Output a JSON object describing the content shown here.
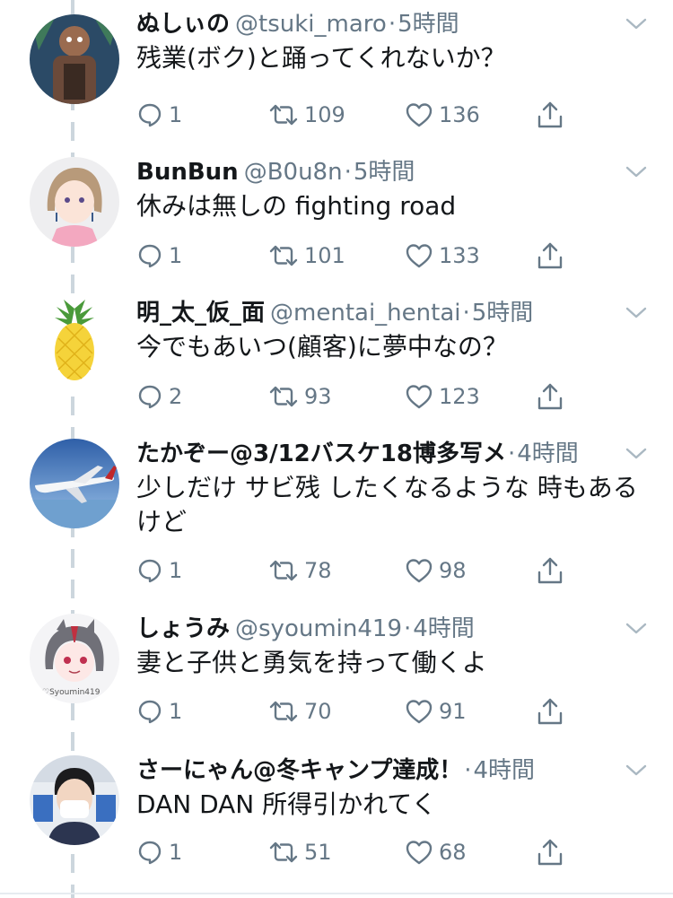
{
  "tweets": [
    {
      "name": "ぬしぃの",
      "handle": "@tsuki_maro",
      "time": "5時間",
      "text": "残業(ボク)と踊ってくれないか？",
      "replies": "1",
      "retweets": "109",
      "likes": "136",
      "avatar": "dark-fantasy-character-avatar"
    },
    {
      "name": "BunBun",
      "handle": "@B0u8n",
      "time": "5時間",
      "text": "休みは無しの fighting road",
      "replies": "1",
      "retweets": "101",
      "likes": "133",
      "avatar": "anime-girl-avatar"
    },
    {
      "name": "明_太_仮_面",
      "handle": "@mentai_hentai",
      "time": "5時間",
      "text": "今でもあいつ(顧客)に夢中なの？",
      "replies": "2",
      "retweets": "93",
      "likes": "123",
      "avatar": "pineapple-avatar"
    },
    {
      "name": "たかぞー@3/12バスケ18博多写メ",
      "handle": "",
      "time": "4時間",
      "text": "少しだけ サビ残 したくなるような 時もあるけど",
      "replies": "1",
      "retweets": "78",
      "likes": "98",
      "avatar": "airplane-avatar"
    },
    {
      "name": "しょうみ",
      "handle": "@syoumin419",
      "time": "4時間",
      "text": "妻と子供と勇気を持って働くよ",
      "replies": "1",
      "retweets": "70",
      "likes": "91",
      "avatar": "anime-character-avatar"
    },
    {
      "name": "さーにゃん@冬キャンプ達成！",
      "handle": "",
      "time": "4時間",
      "text": "DAN DAN 所得引かれてく",
      "replies": "1",
      "retweets": "51",
      "likes": "68",
      "avatar": "person-with-mask-avatar"
    }
  ],
  "separator": "·",
  "colors": {
    "text": "#14171a",
    "secondary": "#657786",
    "thread_line": "#ccd6dd"
  }
}
